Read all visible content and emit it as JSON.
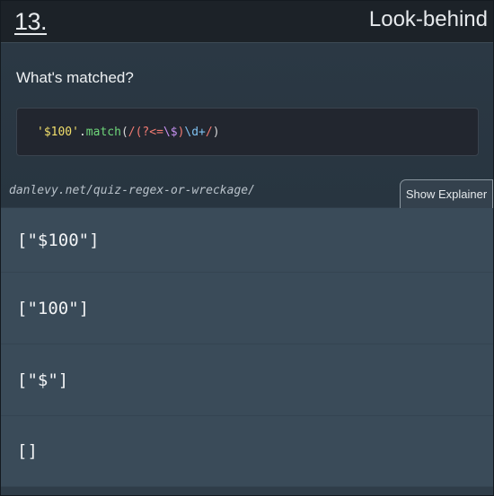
{
  "header": {
    "number": "13.",
    "title": "Look-behind"
  },
  "question": {
    "text": "What's matched?"
  },
  "code": {
    "tokens": [
      {
        "text": "'$100'",
        "kind": "string"
      },
      {
        "text": ".",
        "kind": "op"
      },
      {
        "text": "match",
        "kind": "function"
      },
      {
        "text": "(",
        "kind": "paren"
      },
      {
        "text": "/",
        "kind": "slash"
      },
      {
        "text": "(?<=",
        "kind": "lookbehind"
      },
      {
        "text": "\\$",
        "kind": "escape"
      },
      {
        "text": ")",
        "kind": "lookbehind"
      },
      {
        "text": "\\d+",
        "kind": "digit"
      },
      {
        "text": "/",
        "kind": "slash"
      },
      {
        "text": ")",
        "kind": "paren"
      }
    ]
  },
  "source": {
    "text": "danlevy.net/quiz-regex-or-wreckage/"
  },
  "explainer": {
    "label": "Show Explainer"
  },
  "answers": [
    {
      "label": "[\"$100\"]"
    },
    {
      "label": "[\"100\"]"
    },
    {
      "label": "[\"$\"]"
    },
    {
      "label": "[]"
    }
  ],
  "colors": {
    "header_bg": "#1c2228",
    "body_bg": "#2f3d49",
    "answer_bg": "#3a4b59",
    "code_bg": "#22262f"
  }
}
